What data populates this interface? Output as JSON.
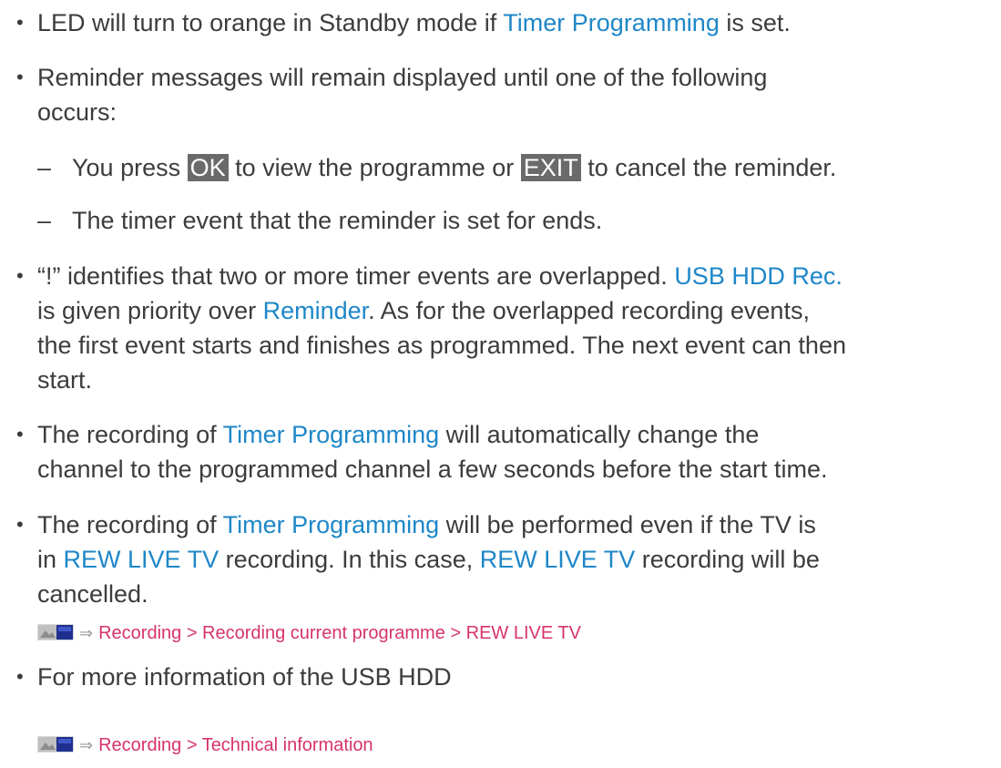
{
  "items": [
    {
      "parts": [
        "LED will turn to orange in Standby mode if ",
        "Timer Programming",
        " is set."
      ]
    },
    {
      "lines": [
        "Reminder messages will remain displayed until one of the following",
        "occurs:"
      ]
    },
    {
      "parts": [
        "You press ",
        "OK",
        " to view the programme or ",
        "EXIT",
        " to cancel the reminder."
      ]
    },
    {
      "text": "The timer event that the reminder is set for ends."
    },
    {
      "line1": [
        "“!” identifies that two or more timer events are overlapped. ",
        "USB HDD Rec."
      ],
      "line2": [
        "is given priority over ",
        "Reminder",
        ". As for the overlapped recording events,"
      ],
      "line3": "the first event starts and finishes as programmed. The next event can then",
      "line4": "start."
    },
    {
      "line1": [
        "The recording of ",
        "Timer Programming",
        " will automatically change the"
      ],
      "line2": "channel to the programmed channel a few seconds before the start time."
    },
    {
      "line1": [
        "The recording of ",
        "Timer Programming",
        " will be performed even if the TV is"
      ],
      "line2": [
        "in ",
        "REW LIVE TV",
        " recording. In this case, ",
        "REW LIVE TV",
        " recording will be"
      ],
      "line3": "cancelled."
    },
    {
      "ref": "Recording > Recording current programme > REW LIVE TV"
    },
    {
      "text": "For more information of the USB HDD"
    },
    {
      "ref": "Recording > Technical information"
    }
  ],
  "icons": {
    "bullet": "•",
    "dash": "–",
    "ref_arrow": "⇒",
    "tv_menu": "tv-menu-icon"
  },
  "colors": {
    "link": "#1e87c8",
    "ref": "#d6336c",
    "key_bg": "#6a6a6a"
  }
}
